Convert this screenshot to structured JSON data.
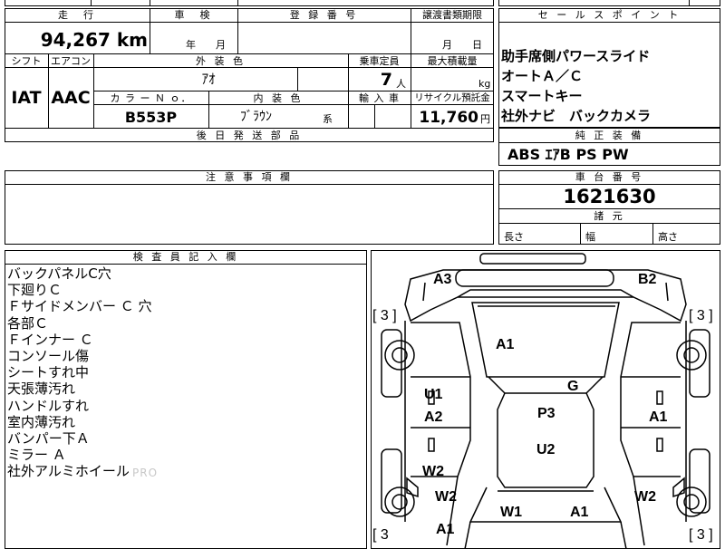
{
  "top_left": {
    "hdr_mileage": "走　行",
    "hdr_inspection": "車　検",
    "hdr_reg_no": "登 録 番 号",
    "hdr_transfer_deadline": "譲渡書類期限",
    "mileage": "94,267 km",
    "inspection_date": "年　　月",
    "transfer_date": "月　　日",
    "hdr_shift": "シフト",
    "hdr_aircon": "エアコン",
    "hdr_exterior_color": "外 装 色",
    "hdr_capacity": "乗車定員",
    "hdr_max_load": "最大積載量",
    "shift": "IAT",
    "aircon": "AAC",
    "exterior_color": "ｱｵ",
    "capacity": "7",
    "capacity_unit": "人",
    "load_unit": "kg",
    "hdr_color_no": "カ ラ ー Ｎ ｏ．",
    "hdr_interior_color": "内 装 色",
    "hdr_import": "輸 入 車",
    "hdr_recycle": "リサイクル預託金",
    "color_no": "B553P",
    "interior_color": "ﾌﾞﾗｳﾝ",
    "interior_suffix": "系",
    "recycle_fee": "11,760",
    "recycle_unit": "円",
    "hdr_later_parts": "後 日 発 送 部 品"
  },
  "sales_points": {
    "header": "セ ー ル ス ポ イ ン ト",
    "items": [
      "助手席側パワースライド",
      "オートＡ／Ｃ",
      "スマートキー",
      "社外ナビ　バックカメラ"
    ]
  },
  "standard_equipment": {
    "header": "純 正 装 備",
    "value": "ABS ｴｱB PS PW"
  },
  "notes": {
    "header": "注 意 事 項 欄"
  },
  "chassis": {
    "header": "車 台 番 号",
    "number": "1621630",
    "dims_header": "諸 元",
    "length_label": "長さ",
    "width_label": "幅",
    "height_label": "高さ"
  },
  "inspector": {
    "header": "検 査 員 記 入 欄",
    "lines": [
      "バックパネルC穴",
      "下廻りＣ",
      "Ｆサイドメンバー Ｃ 穴",
      "各部Ｃ",
      "Ｆインナー Ｃ",
      "コンソール傷",
      "シートすれ中",
      "天張薄汚れ",
      "ハンドルすれ",
      "室内薄汚れ",
      "バンパー下Ａ",
      "ミラー Ａ",
      "社外アルミホイール"
    ],
    "watermark": "PRO"
  },
  "diagram": {
    "tire_tl": "[ 3 ]",
    "tire_tr": "[ 3 ]",
    "tire_bl": "[ 3",
    "tire_br": "[ 3 ]",
    "a3": "A3",
    "b2": "B2",
    "a1_roof": "A1",
    "g": "G",
    "u1": "U1",
    "a2_left": "A2",
    "p3": "P3",
    "a1_right": "A1",
    "u2": "U2",
    "w2_left_upper": "W2",
    "w2_left_lower": "W2",
    "w2_right": "W2",
    "w1": "W1",
    "a1_front_mid": "A1",
    "a1_front_left": "A1"
  }
}
